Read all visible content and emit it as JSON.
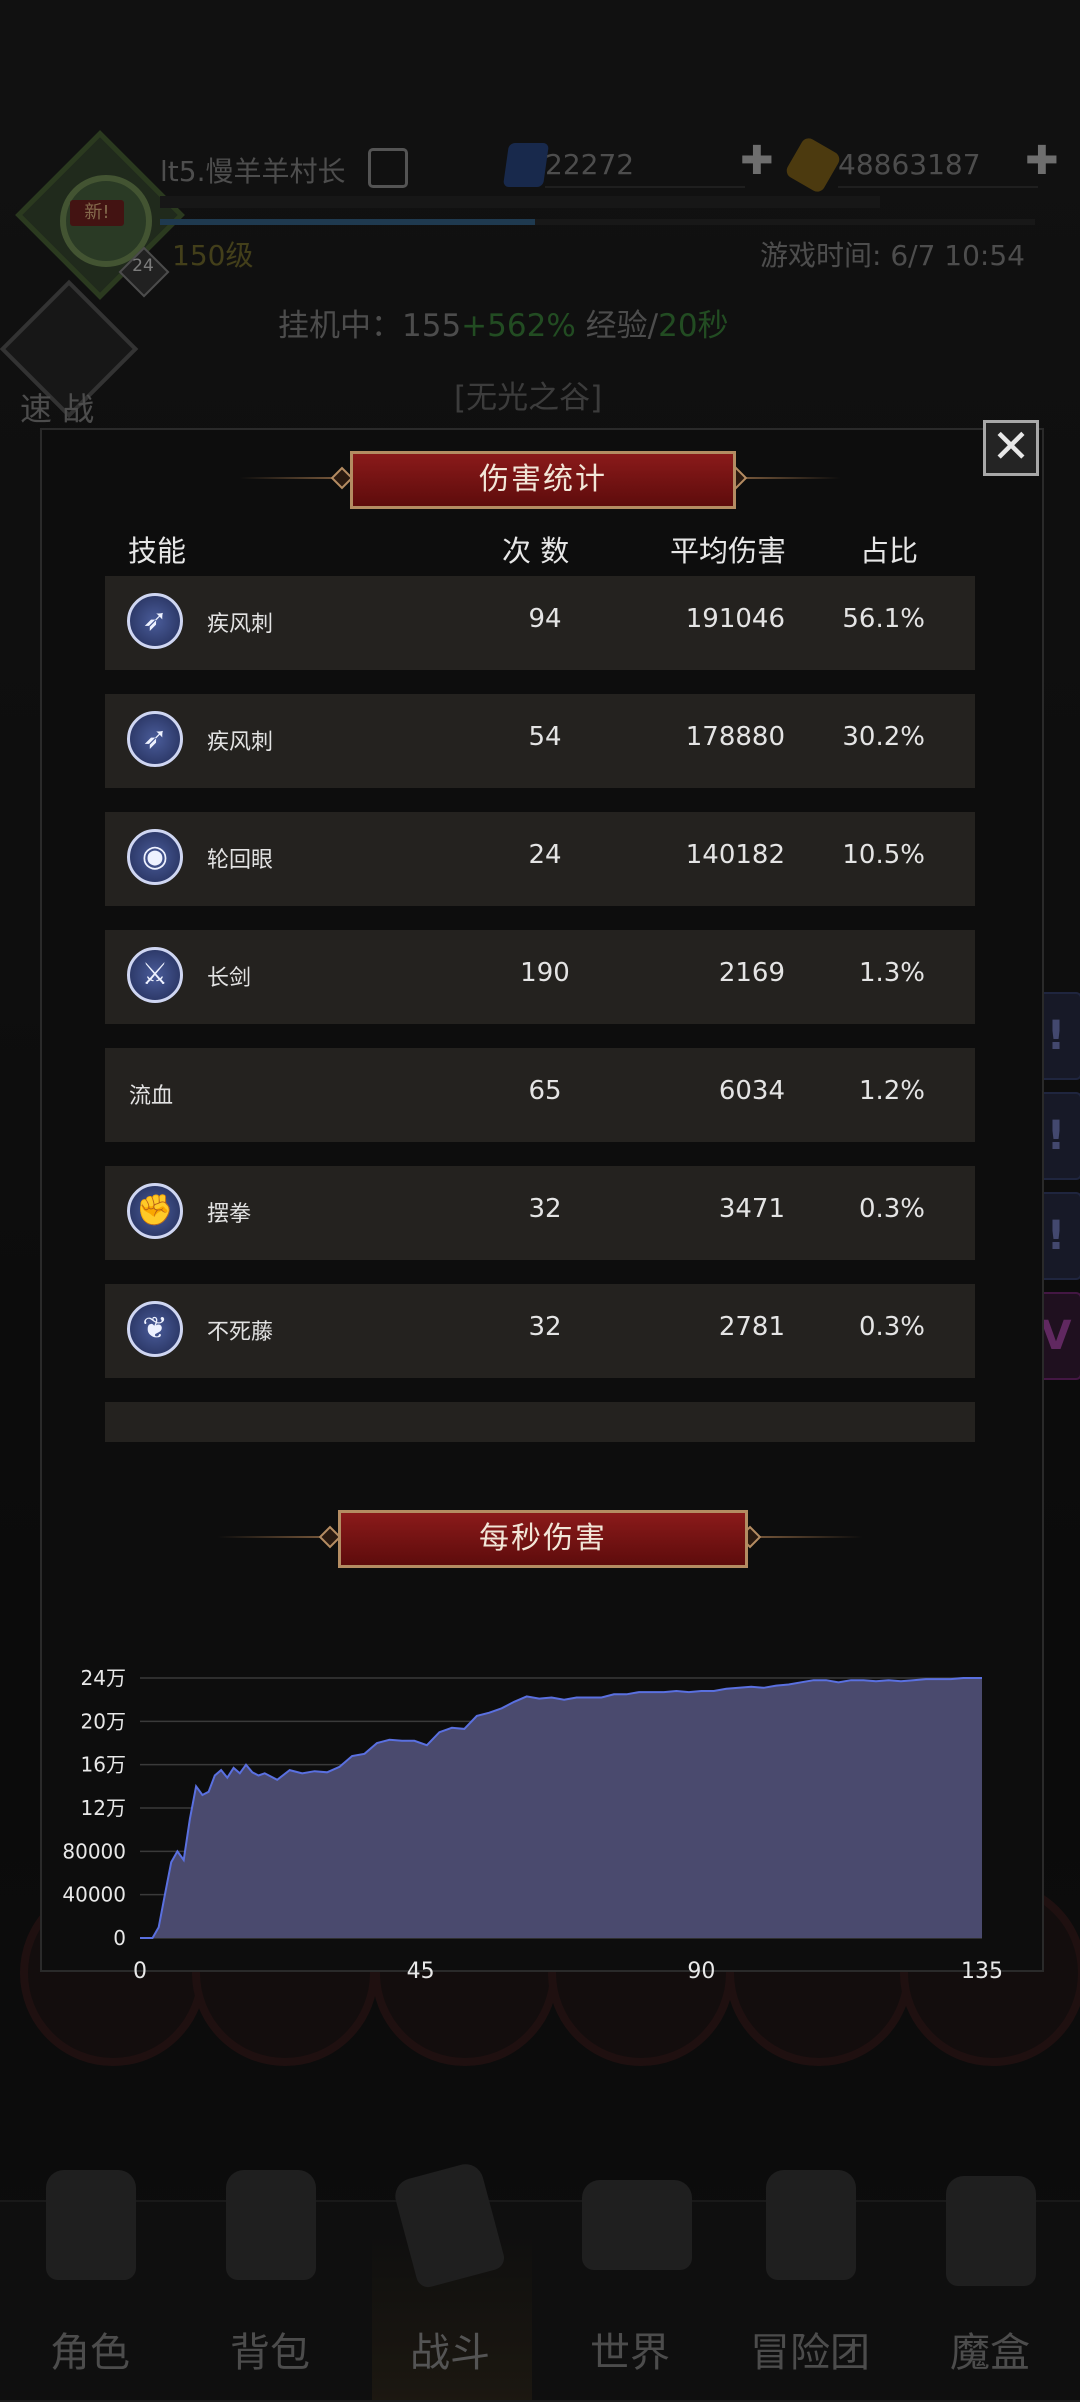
{
  "hud": {
    "player_name": "lt5.慢羊羊村长",
    "new_badge": "新!",
    "badge_level": "24",
    "level": "150级",
    "gems": "22272",
    "gold": "48863187",
    "game_time": "游戏时间: 6/7 10:54",
    "idle_prefix": "挂机中：",
    "idle_value": "155",
    "idle_bonus": "+562%",
    "idle_exp": " 经验/",
    "idle_rate": "20秒",
    "quick_battle": "速 战",
    "location": "[无光之谷]"
  },
  "dialog": {
    "title": "伤害统计",
    "close_label": "✕",
    "headers": {
      "skill": "技能",
      "count": "次 数",
      "avg": "平均伤害",
      "ratio": "占比"
    },
    "rows": [
      {
        "icon": "gale-stab-icon",
        "name": "疾风刺",
        "count": "94",
        "avg": "191046",
        "ratio": "56.1%"
      },
      {
        "icon": "gale-stab-icon",
        "name": "疾风刺",
        "count": "54",
        "avg": "178880",
        "ratio": "30.2%"
      },
      {
        "icon": "samsara-eye-icon",
        "name": "轮回眼",
        "count": "24",
        "avg": "140182",
        "ratio": "10.5%"
      },
      {
        "icon": "long-sword-icon",
        "name": "长剑",
        "count": "190",
        "avg": "2169",
        "ratio": "1.3%"
      },
      {
        "icon": "",
        "name": "流血",
        "count": "65",
        "avg": "6034",
        "ratio": "1.2%"
      },
      {
        "icon": "swing-fist-icon",
        "name": "摆拳",
        "count": "32",
        "avg": "3471",
        "ratio": "0.3%"
      },
      {
        "icon": "undead-vine-icon",
        "name": "不死藤",
        "count": "32",
        "avg": "2781",
        "ratio": "0.3%"
      }
    ],
    "dps_title": "每秒伤害"
  },
  "chart_data": {
    "type": "area",
    "title": "每秒伤害",
    "xlabel": "",
    "ylabel": "",
    "xlim": [
      0,
      135
    ],
    "ylim": [
      0,
      240000
    ],
    "x_ticks": [
      "0",
      "45",
      "90",
      "135"
    ],
    "y_ticks": [
      "0",
      "40000",
      "80000",
      "12万",
      "16万",
      "20万",
      "24万"
    ],
    "grid": true,
    "fill_color": "#4a4a6e",
    "line_color": "#5a70e0",
    "x": [
      0,
      2,
      3,
      4,
      5,
      6,
      7,
      8,
      9,
      10,
      11,
      12,
      13,
      14,
      15,
      16,
      17,
      18,
      19,
      20,
      22,
      24,
      26,
      28,
      30,
      32,
      34,
      36,
      38,
      40,
      42,
      44,
      46,
      48,
      50,
      52,
      54,
      56,
      58,
      60,
      62,
      64,
      66,
      68,
      70,
      72,
      74,
      76,
      78,
      80,
      82,
      84,
      86,
      88,
      90,
      92,
      94,
      96,
      98,
      100,
      102,
      104,
      106,
      108,
      110,
      112,
      114,
      116,
      118,
      120,
      122,
      124,
      126,
      128,
      130,
      132,
      135
    ],
    "y": [
      0,
      0,
      10000,
      40000,
      70000,
      80000,
      72000,
      110000,
      140000,
      132000,
      135000,
      150000,
      155000,
      148000,
      157000,
      152000,
      160000,
      153000,
      150000,
      152000,
      146000,
      155000,
      152000,
      154000,
      153000,
      158000,
      168000,
      170000,
      180000,
      183000,
      182000,
      182000,
      178000,
      190000,
      194000,
      193000,
      205000,
      208000,
      212000,
      218000,
      223000,
      221000,
      222000,
      220000,
      222000,
      222000,
      222000,
      225000,
      225000,
      227000,
      227000,
      227000,
      228000,
      227000,
      228000,
      228000,
      230000,
      231000,
      232000,
      231000,
      233000,
      234000,
      236000,
      238000,
      238000,
      236000,
      238000,
      238000,
      237000,
      238000,
      237000,
      238000,
      239000,
      239000,
      239000,
      240000,
      240000
    ]
  },
  "bg_right": {
    "bars": [
      "!",
      "!",
      "!",
      "V"
    ]
  },
  "nav": {
    "items": [
      {
        "label": "角色",
        "icon": "helmet-icon"
      },
      {
        "label": "背包",
        "icon": "backpack-icon"
      },
      {
        "label": "战斗",
        "icon": "shield-sword-icon"
      },
      {
        "label": "世界",
        "icon": "map-scroll-icon"
      },
      {
        "label": "冒险团",
        "icon": "castle-icon"
      },
      {
        "label": "魔盒",
        "icon": "magic-box-icon"
      }
    ]
  }
}
